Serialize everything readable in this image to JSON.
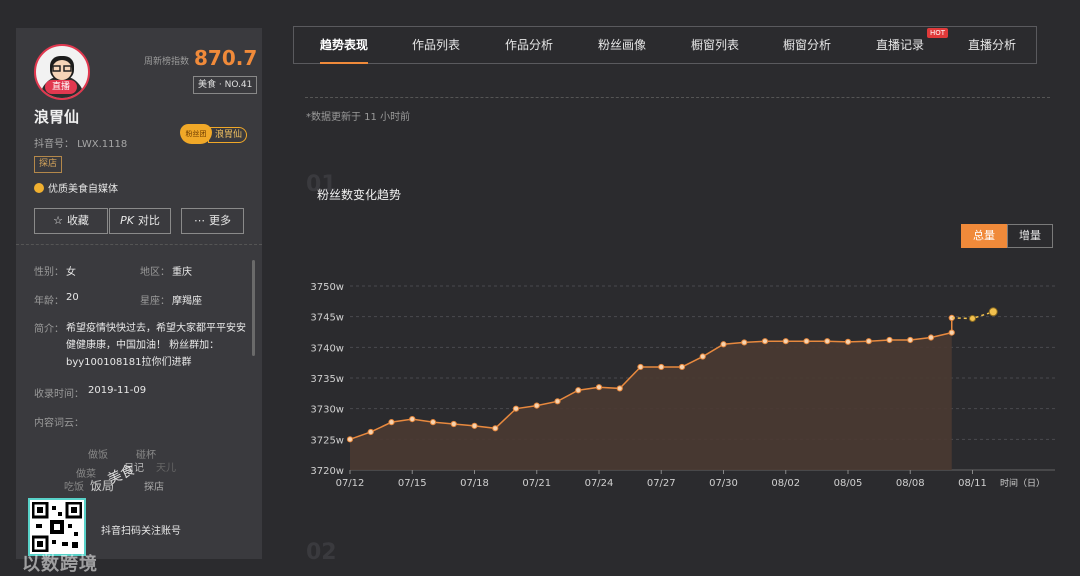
{
  "profile": {
    "live_badge": "直播",
    "rank_label": "周新榜指数",
    "rank_score": "870.7",
    "rank_category": "美食 · NO.41",
    "nickname": "浪胃仙",
    "douyin_id": "抖音号： LWX.1118",
    "tag": "探店",
    "fan_club_badge": "粉丝团",
    "fan_club_name": "浪胃仙",
    "verified_text": "优质美食自媒体",
    "buttons": {
      "collect": "收藏",
      "compare": "对比",
      "more": "更多"
    },
    "info": {
      "gender_label": "性别：",
      "gender": "女",
      "region_label": "地区：",
      "region": "重庆",
      "age_label": "年龄：",
      "age": "20",
      "zodiac_label": "星座：",
      "zodiac": "摩羯座",
      "bio_label": "简介：",
      "bio": "希望疫情快快过去，希望大家都平平安安健健康康，中国加油！ 粉丝群加：byy100108181拉你们进群",
      "collected_label": "收录时间：",
      "collected": "2019-11-09",
      "wordcloud_label": "内容词云："
    },
    "wordcloud": [
      "做饭",
      "碰杯",
      "日记",
      "天儿",
      "做菜",
      "美食",
      "吃饭",
      "饭局",
      "探店"
    ],
    "qr_caption": "抖音扫码关注账号",
    "watermark": "以数跨境"
  },
  "tabs": [
    {
      "label": "趋势表现",
      "active": true
    },
    {
      "label": "作品列表"
    },
    {
      "label": "作品分析"
    },
    {
      "label": "粉丝画像"
    },
    {
      "label": "橱窗列表"
    },
    {
      "label": "橱窗分析"
    },
    {
      "label": "直播记录",
      "badge": "HOT"
    },
    {
      "label": "直播分析"
    }
  ],
  "update_note": "*数据更新于 11 小时前",
  "section": {
    "number": "01",
    "title": "粉丝数变化趋势",
    "next_number": "02"
  },
  "toggle": {
    "total": "总量",
    "increment": "增量"
  },
  "colors": {
    "accent": "#f08a3a",
    "line": "#e8893e",
    "area": "#4a3a32",
    "forecast": "#f2c14e"
  },
  "chart_data": {
    "type": "area",
    "title": "粉丝数变化趋势",
    "xlabel": "时间（日）",
    "ylabel": "",
    "y_tick_labels": [
      "3720w",
      "3725w",
      "3730w",
      "3735w",
      "3740w",
      "3745w",
      "3750w"
    ],
    "ylim": [
      3720,
      3750
    ],
    "x_tick_labels": [
      "07/12",
      "07/15",
      "07/18",
      "07/21",
      "07/24",
      "07/27",
      "07/30",
      "08/02",
      "08/05",
      "08/08",
      "08/11"
    ],
    "grid": true,
    "series": [
      {
        "x": [
          "07/12",
          "07/13",
          "07/14",
          "07/15",
          "07/16",
          "07/17",
          "07/18",
          "07/19",
          "07/20",
          "07/21",
          "07/22",
          "07/23",
          "07/24",
          "07/25",
          "07/26",
          "07/27",
          "07/28",
          "07/29",
          "07/30",
          "07/31",
          "08/01",
          "08/02",
          "08/03",
          "08/04",
          "08/05",
          "08/06",
          "08/07",
          "08/08",
          "08/09",
          "08/10"
        ],
        "values": [
          3725.0,
          3726.2,
          3727.8,
          3728.3,
          3727.8,
          3727.5,
          3727.2,
          3726.8,
          3730.0,
          3730.5,
          3731.2,
          3733.0,
          3733.5,
          3733.3,
          3736.8,
          3736.8,
          3736.8,
          3738.5,
          3740.5,
          3740.8,
          3741.0,
          3741.0,
          3741.0,
          3741.0,
          3740.9,
          3741.0,
          3741.2,
          3741.2,
          3741.6,
          3742.4
        ]
      },
      {
        "x": [
          "08/10",
          "08/11",
          "08/12"
        ],
        "values": [
          3744.8,
          3744.7,
          3745.8
        ]
      }
    ]
  }
}
